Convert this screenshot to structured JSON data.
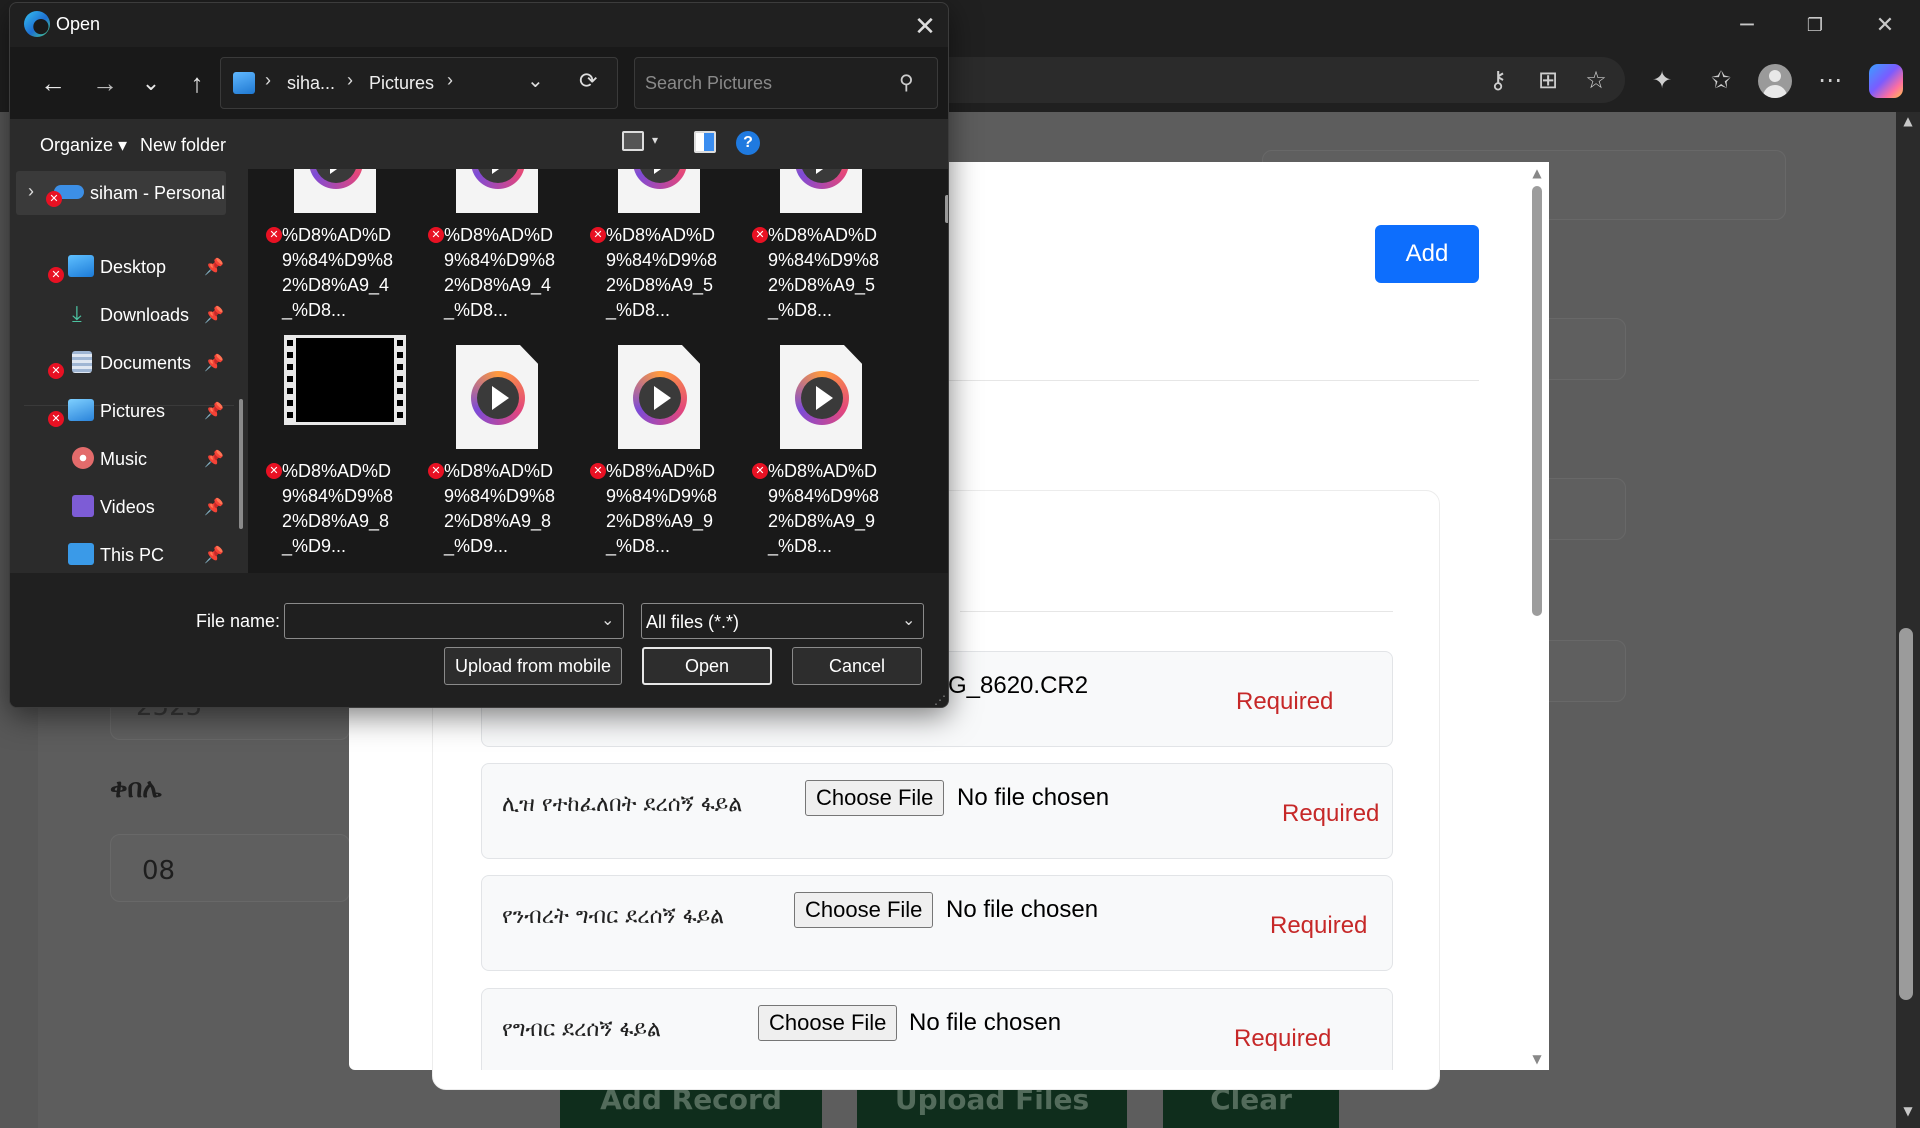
{
  "browser": {
    "window_controls": {
      "minimize": "─",
      "restore": "❐",
      "close": "✕"
    },
    "toolbar_icons": [
      "key-icon",
      "apps-icon",
      "star-icon",
      "extensions-icon",
      "favorites-icon",
      "profile-icon",
      "more-icon",
      "copilot-icon"
    ]
  },
  "page": {
    "background_fields": [
      {
        "text": "2525"
      },
      {
        "text": "ቀበሌ"
      },
      {
        "text": "08"
      }
    ],
    "bottom_buttons": [
      "Add Record",
      "Upload Files",
      "Clear"
    ]
  },
  "modal": {
    "add_button": "Add",
    "file_rows": [
      {
        "label": "",
        "choose": "",
        "status": "G_8620.CR2",
        "required": "Required"
      },
      {
        "label": "ሊዝ የተከፈለበት ደረሰኝ ፋይል",
        "choose": "Choose File",
        "status": "No file chosen",
        "required": "Required"
      },
      {
        "label": "የንብረት ግብር ደረሰኝ ፋይል",
        "choose": "Choose File",
        "status": "No file chosen",
        "required": "Required"
      },
      {
        "label": "የግብር ደረሰኝ ፋይል",
        "choose": "Choose File",
        "status": "No file chosen",
        "required": "Required"
      }
    ]
  },
  "dialog": {
    "title": "Open",
    "close": "✕",
    "nav": {
      "back": "←",
      "forward": "→",
      "recent": "⌄",
      "up": "↑",
      "refresh": "⟳"
    },
    "path": {
      "root": "siha...",
      "folder": "Pictures",
      "sep": "›"
    },
    "search_placeholder": "Search Pictures",
    "commands": {
      "organize": "Organize ▾",
      "new_folder": "New folder",
      "help": "?"
    },
    "sidebar": [
      {
        "label": "siham - Personal",
        "error": true
      },
      {
        "label": "Desktop",
        "pinned": true,
        "error": true
      },
      {
        "label": "Downloads",
        "pinned": true,
        "error": false
      },
      {
        "label": "Documents",
        "pinned": true,
        "error": true
      },
      {
        "label": "Pictures",
        "pinned": true,
        "error": true
      },
      {
        "label": "Music",
        "pinned": true,
        "error": false
      },
      {
        "label": "Videos",
        "pinned": true,
        "error": false
      },
      {
        "label": "This PC",
        "pinned": true,
        "error": false
      }
    ],
    "files": [
      {
        "name": "%D8%AD%D9%84%D9%82%D8%A9_4_%D8...",
        "kind": "video"
      },
      {
        "name": "%D8%AD%D9%84%D9%82%D8%A9_4_%D8...",
        "kind": "video"
      },
      {
        "name": "%D8%AD%D9%84%D9%82%D8%A9_5_%D8...",
        "kind": "video"
      },
      {
        "name": "%D8%AD%D9%84%D9%82%D8%A9_5_%D8...",
        "kind": "video"
      },
      {
        "name": "%D8%AD%D9%84%D9%82%D8%A9_8_%D9...",
        "kind": "film"
      },
      {
        "name": "%D8%AD%D9%84%D9%82%D8%A9_8_%D9...",
        "kind": "video"
      },
      {
        "name": "%D8%AD%D9%84%D9%82%D8%A9_9_%D8...",
        "kind": "video"
      },
      {
        "name": "%D8%AD%D9%84%D9%82%D8%A9_9_%D8...",
        "kind": "video"
      }
    ],
    "file_name_label": "File name:",
    "file_name_value": "",
    "file_type": "All files (*.*)",
    "buttons": {
      "upload_mobile": "Upload from mobile",
      "open": "Open",
      "cancel": "Cancel"
    }
  }
}
